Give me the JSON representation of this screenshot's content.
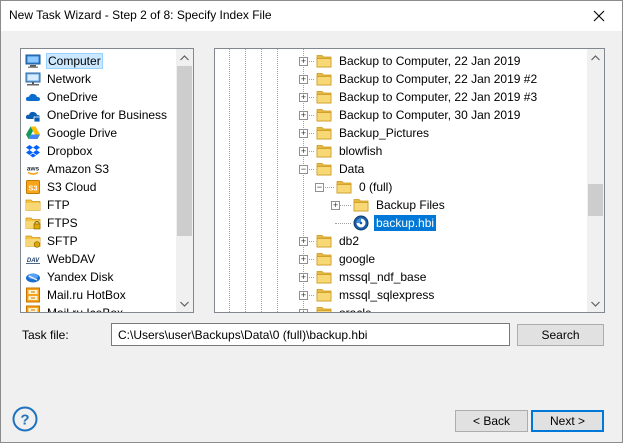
{
  "window": {
    "title": "New Task Wizard - Step 2 of 8: Specify Index File"
  },
  "locations": [
    {
      "label": "Computer",
      "icon": "computer-icon",
      "selected": true
    },
    {
      "label": "Network",
      "icon": "network-icon"
    },
    {
      "label": "OneDrive",
      "icon": "onedrive-icon"
    },
    {
      "label": "OneDrive for Business",
      "icon": "onedrive-business-icon"
    },
    {
      "label": "Google Drive",
      "icon": "google-drive-icon"
    },
    {
      "label": "Dropbox",
      "icon": "dropbox-icon"
    },
    {
      "label": "Amazon S3",
      "icon": "amazon-s3-icon"
    },
    {
      "label": "S3 Cloud",
      "icon": "s3-cloud-icon"
    },
    {
      "label": "FTP",
      "icon": "ftp-icon"
    },
    {
      "label": "FTPS",
      "icon": "ftps-icon"
    },
    {
      "label": "SFTP",
      "icon": "sftp-icon"
    },
    {
      "label": "WebDAV",
      "icon": "webdav-icon"
    },
    {
      "label": "Yandex Disk",
      "icon": "yandex-disk-icon"
    },
    {
      "label": "Mail.ru HotBox",
      "icon": "mailru-hotbox-icon"
    },
    {
      "label": "Mail.ru IceBox",
      "icon": "mailru-icebox-icon"
    }
  ],
  "tree": [
    {
      "label": "Backup to Computer, 22 Jan 2019",
      "level": 0,
      "expander": "+",
      "icon": "folder-icon"
    },
    {
      "label": "Backup to Computer, 22 Jan 2019 #2",
      "level": 0,
      "expander": "+",
      "icon": "folder-icon"
    },
    {
      "label": "Backup to Computer, 22 Jan 2019 #3",
      "level": 0,
      "expander": "+",
      "icon": "folder-icon"
    },
    {
      "label": "Backup to Computer, 30 Jan 2019",
      "level": 0,
      "expander": "+",
      "icon": "folder-icon"
    },
    {
      "label": "Backup_Pictures",
      "level": 0,
      "expander": "+",
      "icon": "folder-icon"
    },
    {
      "label": "blowfish",
      "level": 0,
      "expander": "+",
      "icon": "folder-icon"
    },
    {
      "label": "Data",
      "level": 0,
      "expander": "-",
      "icon": "folder-icon"
    },
    {
      "label": "0 (full)",
      "level": 1,
      "expander": "-",
      "icon": "folder-icon"
    },
    {
      "label": "Backup Files",
      "level": 2,
      "expander": "+",
      "icon": "folder-icon"
    },
    {
      "label": "backup.hbi",
      "level": 2,
      "expander": "",
      "icon": "hbi-file-icon",
      "selected": true
    },
    {
      "label": "db2",
      "level": 0,
      "expander": "+",
      "icon": "folder-icon"
    },
    {
      "label": "google",
      "level": 0,
      "expander": "+",
      "icon": "folder-icon"
    },
    {
      "label": "mssql_ndf_base",
      "level": 0,
      "expander": "+",
      "icon": "folder-icon"
    },
    {
      "label": "mssql_sqlexpress",
      "level": 0,
      "expander": "+",
      "icon": "folder-icon"
    },
    {
      "label": "oracle",
      "level": 0,
      "expander": "+",
      "icon": "folder-icon"
    }
  ],
  "task_file": {
    "label": "Task file:",
    "value": "C:\\Users\\user\\Backups\\Data\\0 (full)\\backup.hbi"
  },
  "buttons": {
    "search": "Search",
    "back": "< Back",
    "next": "Next >"
  },
  "colors": {
    "selection": "#0078d7",
    "folder": "#f8d775"
  }
}
